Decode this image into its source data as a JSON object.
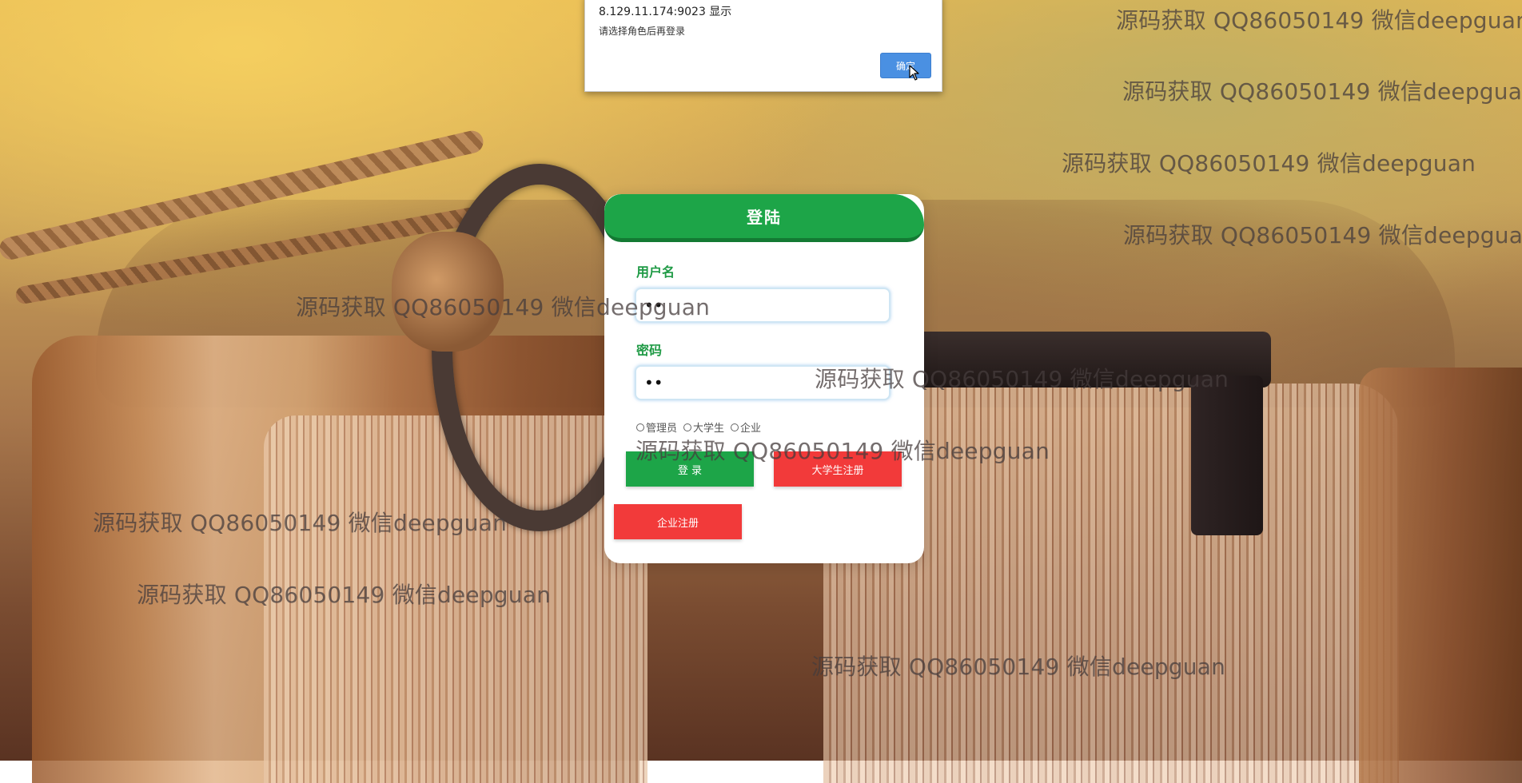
{
  "background": {
    "watermark_text": "源码获取 QQ86050149 微信deepguan"
  },
  "dialog": {
    "title": "8.129.11.174:9023 显示",
    "message": "请选择角色后再登录",
    "ok_label": "确定"
  },
  "login": {
    "title": "登陆",
    "username_label": "用户名",
    "username_value": "••",
    "password_label": "密码",
    "password_value": "••",
    "roles": [
      {
        "label": "管理员",
        "selected": false
      },
      {
        "label": "大学生",
        "selected": false
      },
      {
        "label": "企业",
        "selected": false
      }
    ],
    "login_button": "登 录",
    "student_register_button": "大学生注册",
    "company_register_button": "企业注册"
  },
  "colors": {
    "primary_green": "#1da548",
    "danger_red": "#f23a3a",
    "dialog_button_blue": "#4a90e2"
  },
  "icons": {
    "cursor": "mouse-pointer-icon",
    "radio": "radio-circle-icon"
  }
}
